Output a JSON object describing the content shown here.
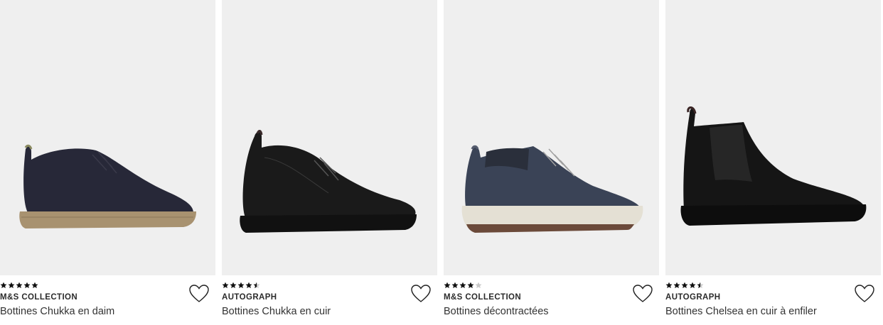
{
  "products": [
    {
      "brand": "M&S COLLECTION",
      "title": "Bottines Chukka en daim",
      "rating": 5,
      "image": "navy-suede-chukka-boot",
      "colors": {
        "upper": "#272838",
        "sole": "#a89270"
      }
    },
    {
      "brand": "AUTOGRAPH",
      "title": "Bottines Chukka en cuir",
      "rating": 4.5,
      "image": "black-leather-chukka-boot",
      "colors": {
        "upper": "#1a1a1a",
        "sole": "#111111"
      }
    },
    {
      "brand": "M&S COLLECTION",
      "title": "Bottines décontractées",
      "rating": 4,
      "image": "navy-casual-boot",
      "colors": {
        "upper": "#3a4356",
        "sole": "#e4e0d4"
      }
    },
    {
      "brand": "AUTOGRAPH",
      "title": "Bottines Chelsea en cuir à enfiler",
      "rating": 4.5,
      "image": "black-chelsea-boot",
      "colors": {
        "upper": "#151515",
        "sole": "#0d0d0d"
      }
    }
  ],
  "wishlist_icon": "heart-outline-icon",
  "star_icon": "star-icon"
}
